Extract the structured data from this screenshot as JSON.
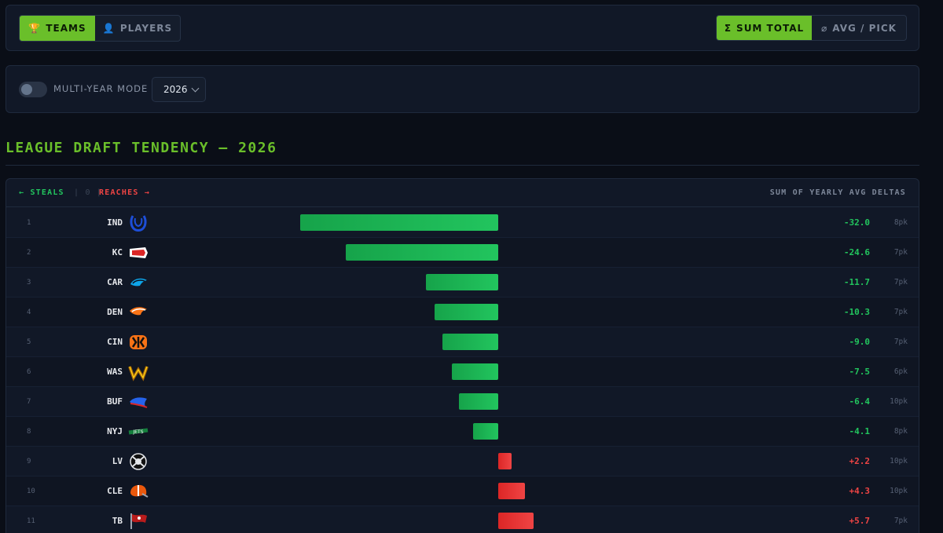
{
  "tabs": {
    "teams": {
      "icon": "🏆",
      "label": "TEAMS"
    },
    "players": {
      "icon": "👤",
      "label": "PLAYERS"
    }
  },
  "metric_toggle": {
    "sum": {
      "icon": "Σ",
      "label": "SUM TOTAL"
    },
    "avg": {
      "icon": "⌀",
      "label": "AVG / PICK"
    }
  },
  "filters": {
    "multi_year_label": "MULTI-YEAR MODE",
    "multi_year_on": false,
    "year": "2026"
  },
  "colors": {
    "accent": "#6abf2a",
    "steal": "#22c55e",
    "reach": "#ef4444"
  },
  "chart_data": {
    "type": "bar",
    "orientation": "horizontal",
    "title": "LEAGUE DRAFT TENDENCY — 2026",
    "legend": {
      "steals": "← STEALS",
      "zero": "| 0 |",
      "reaches": "REACHES →"
    },
    "value_label": "SUM OF YEARLY AVG DELTAS",
    "xlim": [
      -38,
      35
    ],
    "rows": [
      {
        "rank": "1",
        "team": "IND",
        "logo": "ind-horseshoe-icon",
        "value": -32.0,
        "value_text": "-32.0",
        "picks": "8pk"
      },
      {
        "rank": "2",
        "team": "KC",
        "logo": "kc-arrowhead-icon",
        "value": -24.6,
        "value_text": "-24.6",
        "picks": "7pk"
      },
      {
        "rank": "3",
        "team": "CAR",
        "logo": "car-panther-icon",
        "value": -11.7,
        "value_text": "-11.7",
        "picks": "7pk"
      },
      {
        "rank": "4",
        "team": "DEN",
        "logo": "den-bronco-icon",
        "value": -10.3,
        "value_text": "-10.3",
        "picks": "7pk"
      },
      {
        "rank": "5",
        "team": "CIN",
        "logo": "cin-stripes-icon",
        "value": -9.0,
        "value_text": "-9.0",
        "picks": "7pk"
      },
      {
        "rank": "6",
        "team": "WAS",
        "logo": "was-w-icon",
        "value": -7.5,
        "value_text": "-7.5",
        "picks": "6pk"
      },
      {
        "rank": "7",
        "team": "BUF",
        "logo": "buf-bison-icon",
        "value": -6.4,
        "value_text": "-6.4",
        "picks": "10pk"
      },
      {
        "rank": "8",
        "team": "NYJ",
        "logo": "nyj-jets-icon",
        "value": -4.1,
        "value_text": "-4.1",
        "picks": "8pk"
      },
      {
        "rank": "9",
        "team": "LV",
        "logo": "lv-shield-icon",
        "value": 2.2,
        "value_text": "+2.2",
        "picks": "10pk"
      },
      {
        "rank": "10",
        "team": "CLE",
        "logo": "cle-helmet-icon",
        "value": 4.3,
        "value_text": "+4.3",
        "picks": "10pk"
      },
      {
        "rank": "11",
        "team": "TB",
        "logo": "tb-flag-icon",
        "value": 5.7,
        "value_text": "+5.7",
        "picks": "7pk"
      }
    ]
  }
}
